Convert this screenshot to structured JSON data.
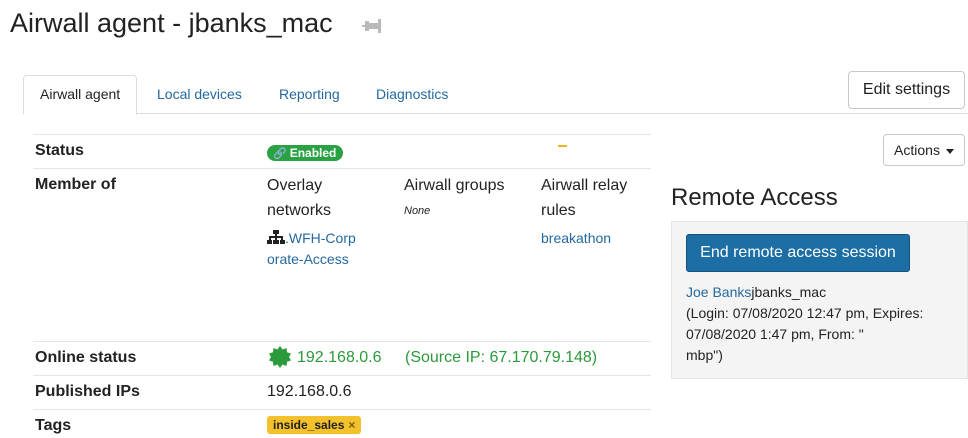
{
  "page": {
    "title": "Airwall agent - jbanks_mac"
  },
  "icons": {
    "pin": "pin-icon",
    "link": "link-icon",
    "network": "network-icon",
    "online": "online-status-icon",
    "caret": "caret-down-icon",
    "remove": "close-icon"
  },
  "tabs": [
    {
      "label": "Airwall agent"
    },
    {
      "label": "Local devices"
    },
    {
      "label": "Reporting"
    },
    {
      "label": "Diagnostics"
    }
  ],
  "buttons": {
    "edit_settings": "Edit settings",
    "actions": "Actions",
    "end_session": "End remote access session"
  },
  "status": {
    "label": "Status",
    "badge": "Enabled"
  },
  "member_of": {
    "label": "Member of",
    "overlay_networks": {
      "header_line1": "Overlay",
      "header_line2": "networks",
      "value_line1": ".WFH-Corp",
      "value_line2": "orate-Access"
    },
    "airwall_groups": {
      "header": "Airwall groups",
      "value": "None"
    },
    "relay_rules": {
      "header_line1": "Airwall relay",
      "header_line2": "rules",
      "value": "breakathon"
    }
  },
  "online_status": {
    "label": "Online status",
    "ip": "192.168.0.6",
    "source": "(Source IP: 67.170.79.148)"
  },
  "published_ips": {
    "label": "Published IPs",
    "value": "192.168.0.6"
  },
  "tags": {
    "label": "Tags",
    "items": [
      "inside_sales"
    ],
    "remove_glyph": "×"
  },
  "remote_access": {
    "title": "Remote Access",
    "user_link": "Joe Banks",
    "device": "jbanks_mac",
    "line2": "(Login: 07/08/2020 12:47 pm, Expires:",
    "line3": "07/08/2020 1:47 pm, From: \"",
    "line4": "mbp\")"
  },
  "colors": {
    "link": "#2469a0",
    "enabled_badge": "#2aa243",
    "online_green": "#2b9a3a",
    "tag_yellow": "#f3c12b",
    "primary_button": "#1c6ea4"
  }
}
